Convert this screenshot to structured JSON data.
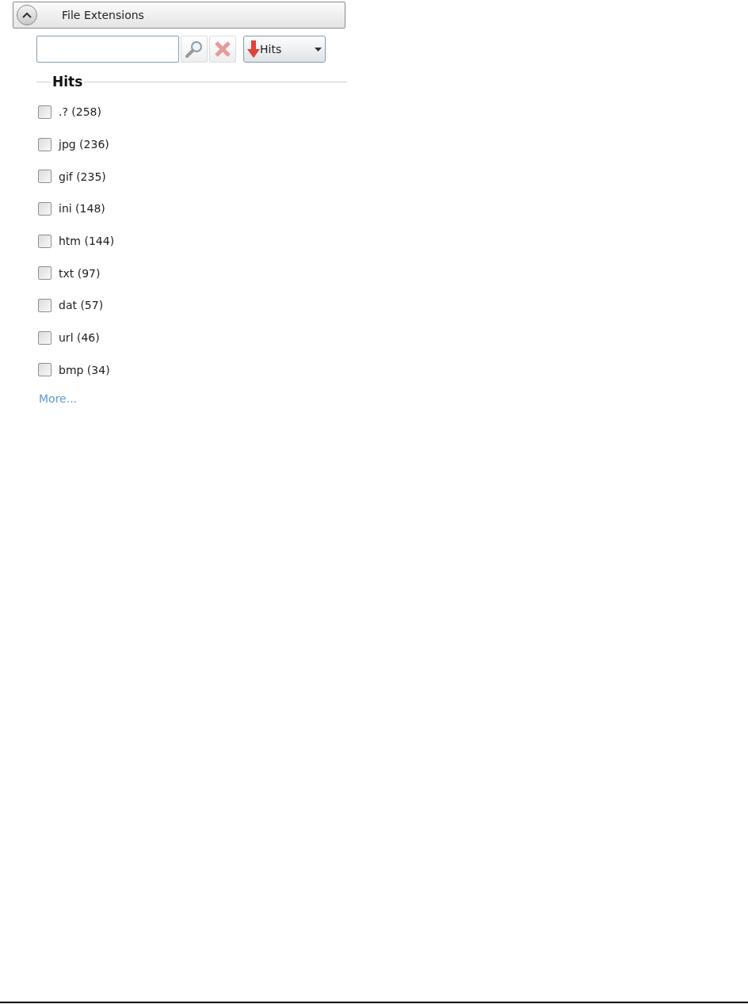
{
  "panel": {
    "title": "File Extensions",
    "expanded": true
  },
  "sort_button": {
    "label": "Hits"
  },
  "group": {
    "title": "Hits"
  },
  "items": [
    {
      "label": ".? (258)",
      "checked": false
    },
    {
      "label": "jpg (236)",
      "checked": false
    },
    {
      "label": "gif (235)",
      "checked": false
    },
    {
      "label": "ini (148)",
      "checked": false
    },
    {
      "label": "htm (144)",
      "checked": false
    },
    {
      "label": "txt (97)",
      "checked": false
    },
    {
      "label": "dat (57)",
      "checked": false
    },
    {
      "label": "url (46)",
      "checked": false
    },
    {
      "label": "bmp (34)",
      "checked": false
    }
  ],
  "more_link": "More..."
}
